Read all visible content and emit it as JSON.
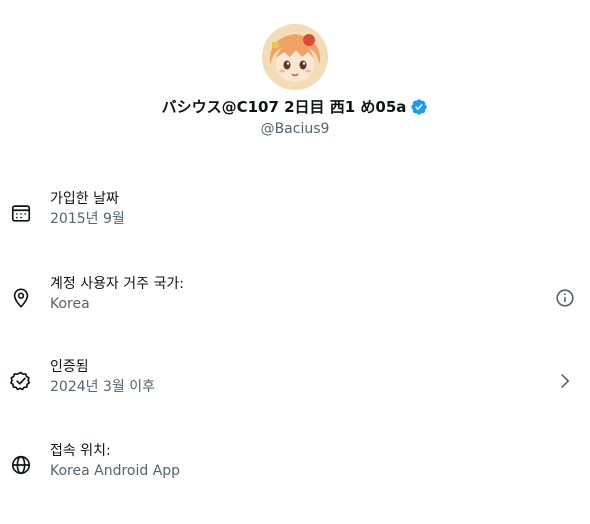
{
  "profile": {
    "display_name": "バシウス@C107 2日目 西1 め05a",
    "handle": "@Bacius9",
    "avatar_icon": "anime-avatar",
    "verified_icon": "verified-badge-icon",
    "verified_color": "#1d9bf0"
  },
  "info_rows": [
    {
      "icon": "calendar-icon",
      "title": "가입한 날짜",
      "subtitle": "2015년 9월",
      "action_icon": null
    },
    {
      "icon": "location-pin-icon",
      "title": "계정 사용자 거주 국가:",
      "subtitle": "Korea",
      "action_icon": "info-icon"
    },
    {
      "icon": "verified-check-icon",
      "title": "인증됨",
      "subtitle": "2024년 3월 이후",
      "action_icon": "chevron-right-icon"
    },
    {
      "icon": "globe-icon",
      "title": "접속 위치:",
      "subtitle": "Korea Android App",
      "action_icon": null
    }
  ],
  "colors": {
    "primary_text": "#0f1419",
    "secondary_text": "#536471",
    "accent": "#1d9bf0"
  }
}
